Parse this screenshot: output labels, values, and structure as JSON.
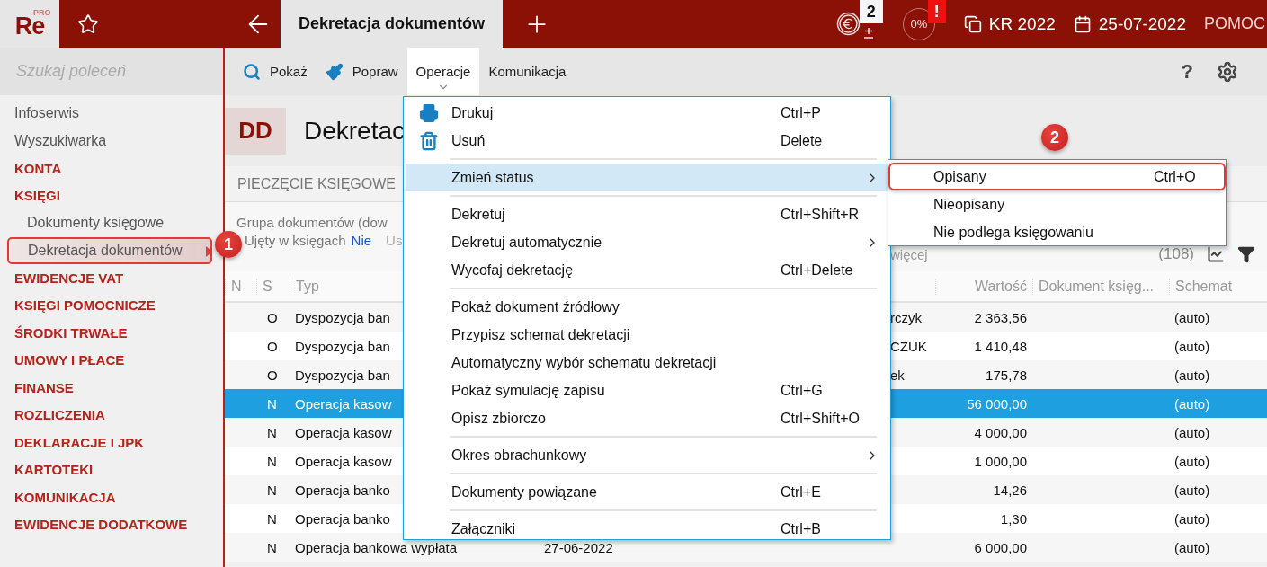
{
  "header_bar": {
    "logo": "Re",
    "edition": "PRO",
    "active_tab": "Dekretacja dokumentów",
    "currency_badge": "2",
    "progress": "0%",
    "alert_badge": "!",
    "company": "KR 2022",
    "date": "25-07-2022",
    "help": "POMOC"
  },
  "sidebar": {
    "search_placeholder": "Szukaj poleceń",
    "items": [
      {
        "label": "Infoserwis",
        "kind": "link",
        "selected": false
      },
      {
        "label": "Wyszukiwarka",
        "kind": "link",
        "selected": false
      },
      {
        "label": "KONTA",
        "kind": "section",
        "selected": false
      },
      {
        "label": "KSIĘGI",
        "kind": "section",
        "selected": false,
        "children": [
          {
            "label": "Dokumenty księgowe",
            "kind": "link",
            "selected": false
          },
          {
            "label": "Dekretacja dokumentów",
            "kind": "link",
            "selected": true
          }
        ]
      },
      {
        "label": "EWIDENCJE VAT",
        "kind": "section",
        "selected": false
      },
      {
        "label": "KSIĘGI POMOCNICZE",
        "kind": "section",
        "selected": false
      },
      {
        "label": "ŚRODKI TRWAŁE",
        "kind": "section",
        "selected": false
      },
      {
        "label": "UMOWY I PŁACE",
        "kind": "section",
        "selected": false
      },
      {
        "label": "FINANSE",
        "kind": "section",
        "selected": false
      },
      {
        "label": "ROZLICZENIA",
        "kind": "section",
        "selected": false
      },
      {
        "label": "DEKLARACJE I JPK",
        "kind": "section",
        "selected": false
      },
      {
        "label": "KARTOTEKI",
        "kind": "section",
        "selected": false
      },
      {
        "label": "KOMUNIKACJA",
        "kind": "section",
        "selected": false
      },
      {
        "label": "EWIDENCJE DODATKOWE",
        "kind": "section",
        "selected": false
      }
    ]
  },
  "toolbar": {
    "items": [
      {
        "label": "Pokaż",
        "selected": false
      },
      {
        "label": "Popraw",
        "selected": false
      },
      {
        "label": "Operacje",
        "selected": true
      },
      {
        "label": "Komunikacja",
        "selected": false
      }
    ],
    "help_label": "?"
  },
  "page": {
    "badge": "DD",
    "title": "Dekretac",
    "section": "PIECZĘCIE KSIĘGOWE",
    "filter_line": "Grupa dokumentów (dow",
    "filter_label": "Ujęty w księgach",
    "filter_value": "Nie",
    "filter_more": "Us",
    "more_link": "więcej",
    "count": "(108)"
  },
  "table": {
    "columns": [
      "N",
      "S",
      "Typ",
      "Wartość",
      "Dokument księg...",
      "Schemat"
    ],
    "rows": [
      {
        "s": "O",
        "type": "Dyspozycja ban",
        "name": "rczyk",
        "value": "2 363,56",
        "schema": "(auto)",
        "selected": false
      },
      {
        "s": "O",
        "type": "Dyspozycja ban",
        "name": "CZUK",
        "value": "1 410,48",
        "schema": "(auto)",
        "selected": false
      },
      {
        "s": "O",
        "type": "Dyspozycja ban",
        "name": "ek",
        "value": "175,78",
        "schema": "(auto)",
        "selected": false
      },
      {
        "s": "N",
        "type": "Operacja kasow",
        "value": "56 000,00",
        "schema": "(auto)",
        "selected": true
      },
      {
        "s": "N",
        "type": "Operacja kasow",
        "value": "4 000,00",
        "schema": "(auto)",
        "selected": false
      },
      {
        "s": "N",
        "type": "Operacja kasow",
        "value": "1 000,00",
        "schema": "(auto)",
        "selected": false
      },
      {
        "s": "N",
        "type": "Operacja banko",
        "value": "14,26",
        "schema": "(auto)",
        "selected": false
      },
      {
        "s": "N",
        "type": "Operacja banko",
        "value": "1,30",
        "schema": "(auto)",
        "selected": false
      },
      {
        "s": "N",
        "type": "Operacja bankowa wypłata",
        "date": "27-06-2022",
        "value": "6 000,00",
        "schema": "(auto)",
        "selected": false
      }
    ]
  },
  "operations_menu": {
    "items": [
      {
        "kind": "item",
        "label": "Drukuj",
        "shortcut": "Ctrl+P",
        "selected": false
      },
      {
        "kind": "item",
        "label": "Usuń",
        "shortcut": "Delete",
        "selected": false
      },
      {
        "kind": "separator"
      },
      {
        "kind": "submenu",
        "label": "Zmień status",
        "selected": true,
        "submenu": {
          "items": [
            {
              "label": "Opisany",
              "shortcut": "Ctrl+O",
              "annotated": true
            },
            {
              "label": "Nieopisany",
              "annotated": false
            },
            {
              "label": "Nie podlega księgowaniu",
              "annotated": false
            }
          ]
        }
      },
      {
        "kind": "separator"
      },
      {
        "kind": "item",
        "label": "Dekretuj",
        "shortcut": "Ctrl+Shift+R",
        "selected": false
      },
      {
        "kind": "submenu",
        "label": "Dekretuj automatycznie",
        "selected": false
      },
      {
        "kind": "item",
        "label": "Wycofaj dekretację",
        "shortcut": "Ctrl+Delete",
        "selected": false
      },
      {
        "kind": "separator"
      },
      {
        "kind": "item",
        "label": "Pokaż dokument źródłowy",
        "selected": false
      },
      {
        "kind": "item",
        "label": "Przypisz schemat dekretacji",
        "selected": false
      },
      {
        "kind": "item",
        "label": "Automatyczny wybór schematu dekretacji",
        "selected": false
      },
      {
        "kind": "item",
        "label": "Pokaż symulację zapisu",
        "shortcut": "Ctrl+G",
        "selected": false
      },
      {
        "kind": "item",
        "label": "Opisz zbiorczo",
        "shortcut": "Ctrl+Shift+O",
        "selected": false
      },
      {
        "kind": "separator"
      },
      {
        "kind": "submenu",
        "label": "Okres obrachunkowy",
        "selected": false
      },
      {
        "kind": "separator"
      },
      {
        "kind": "item",
        "label": "Dokumenty powiązane",
        "shortcut": "Ctrl+E",
        "selected": false
      },
      {
        "kind": "separator"
      },
      {
        "kind": "item",
        "label": "Załączniki",
        "shortcut": "Ctrl+B",
        "selected": false
      }
    ]
  },
  "callouts": [
    {
      "label": "1"
    },
    {
      "label": "2"
    }
  ]
}
